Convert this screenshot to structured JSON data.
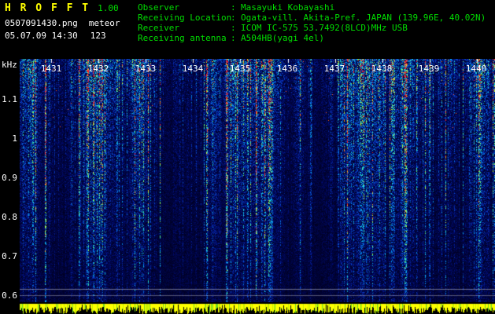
{
  "app": {
    "title": "H R O F F T",
    "version": "1.00",
    "filename": "0507091430.png",
    "mode": "meteor",
    "datetime": "05.07.09 14:30",
    "count": "123"
  },
  "info": {
    "separator": ":",
    "rows": [
      {
        "label": "Observer",
        "value": "Masayuki Kobayashi"
      },
      {
        "label": "Receiving Location",
        "value": "Ogata-vill. Akita-Pref. JAPAN (139.96E, 40.02N)"
      },
      {
        "label": "Receiver",
        "value": "ICOM IC-575 53.7492(8LCD)MHz USB"
      },
      {
        "label": "Receiving antenna",
        "value": "A504HB(yagi 4el)"
      }
    ]
  },
  "chart_data": {
    "type": "heatmap",
    "title": "HROFFT radio meteor echo spectrogram",
    "ylabel": "kHz",
    "y_ticks": [
      "1.1",
      "1",
      "0.9",
      "0.8",
      "0.7",
      "0.6"
    ],
    "y_range_khz": [
      0.55,
      1.2
    ],
    "x_ticks": [
      "1431",
      "1432",
      "1433",
      "1434",
      "1435",
      "1436",
      "1437",
      "1438",
      "1439",
      "1440"
    ],
    "x_axis": "time (HHMM), 10 minute span",
    "legend_position": "none",
    "grid": "two faint horizontal reference lines near 0.6 kHz",
    "notes": "Blue noise background with brighter cyan/green vertical signal streaks, dense near top; yellow signal-level bar strip along the bottom edge"
  },
  "spectrogram": {
    "unit": "kHz",
    "freq_labels": [
      "1.1",
      "1",
      "0.9",
      "0.8",
      "0.7",
      "0.6"
    ],
    "time_labels": [
      "1431",
      "1432",
      "1433",
      "1434",
      "1435",
      "1436",
      "1437",
      "1438",
      "1439",
      "1440"
    ]
  },
  "colors": {
    "title": "#ffff00",
    "version": "#00dd00",
    "info_text": "#00dd00",
    "axis_text": "#ffffff",
    "background": "#000000",
    "level_bars": "#ffff00"
  }
}
